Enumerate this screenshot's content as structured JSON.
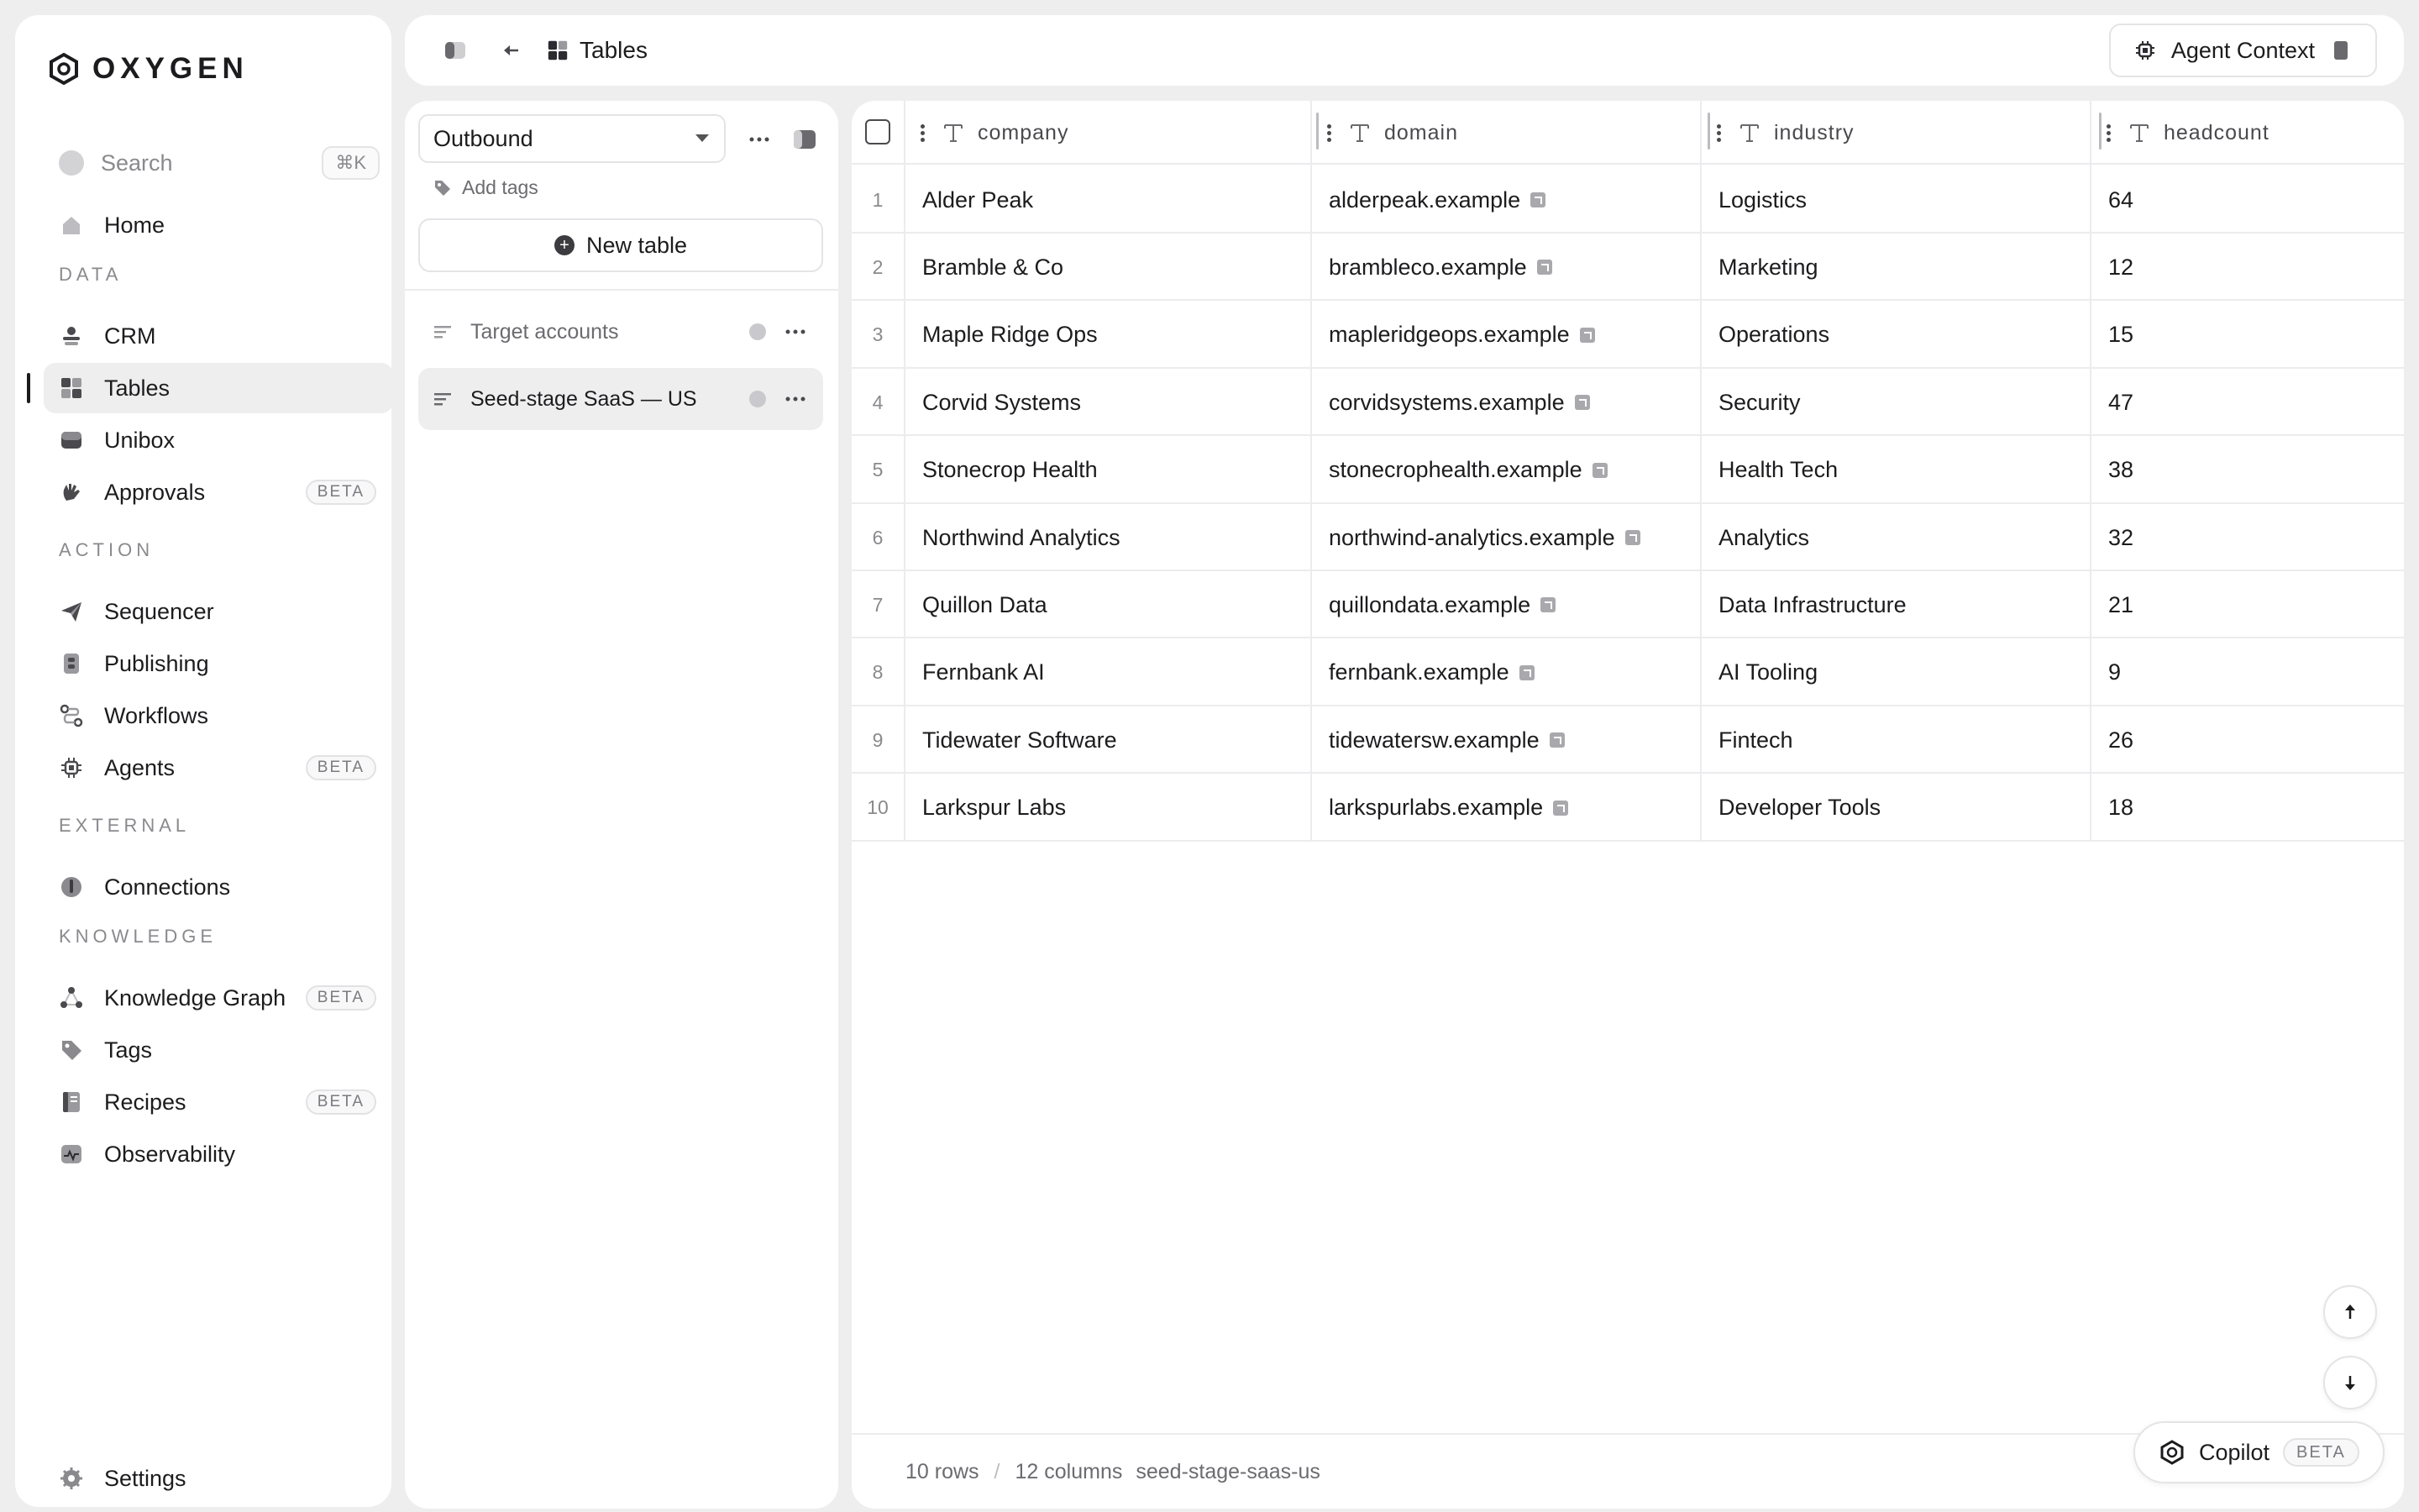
{
  "app": {
    "brand": "OXYGEN"
  },
  "sidebar": {
    "search": {
      "label": "Search",
      "shortcut": "⌘K"
    },
    "home": {
      "label": "Home"
    },
    "sections": [
      {
        "label": "DATA",
        "items": [
          {
            "label": "CRM",
            "icon": "users-icon"
          },
          {
            "label": "Tables",
            "icon": "grid-icon",
            "active": true
          },
          {
            "label": "Unibox",
            "icon": "inbox-icon"
          },
          {
            "label": "Approvals",
            "icon": "hand-icon",
            "badge": "BETA"
          }
        ]
      },
      {
        "label": "ACTION",
        "items": [
          {
            "label": "Sequencer",
            "icon": "send-icon"
          },
          {
            "label": "Publishing",
            "icon": "document-icon"
          },
          {
            "label": "Workflows",
            "icon": "workflow-icon"
          },
          {
            "label": "Agents",
            "icon": "chip-icon",
            "badge": "BETA"
          }
        ]
      },
      {
        "label": "EXTERNAL",
        "items": [
          {
            "label": "Connections",
            "icon": "plug-icon"
          }
        ]
      },
      {
        "label": "KNOWLEDGE",
        "items": [
          {
            "label": "Knowledge Graph",
            "icon": "graph-icon",
            "badge": "BETA"
          },
          {
            "label": "Tags",
            "icon": "tag-icon"
          },
          {
            "label": "Recipes",
            "icon": "book-icon",
            "badge": "BETA"
          },
          {
            "label": "Observability",
            "icon": "pulse-icon"
          }
        ]
      }
    ],
    "settings": {
      "label": "Settings"
    }
  },
  "header": {
    "breadcrumb": "Tables",
    "agent_context": "Agent Context"
  },
  "tables_panel": {
    "workspace": "Outbound",
    "add_tags": "Add tags",
    "new_table": "New table",
    "tables": [
      {
        "label": "Target accounts",
        "active": false
      },
      {
        "label": "Seed-stage SaaS — US",
        "active": true
      }
    ]
  },
  "grid": {
    "columns": [
      "company",
      "domain",
      "industry",
      "headcount"
    ],
    "rows": [
      {
        "n": "1",
        "company": "Alder Peak",
        "domain": "alderpeak.example",
        "industry": "Logistics",
        "headcount": "64"
      },
      {
        "n": "2",
        "company": "Bramble & Co",
        "domain": "brambleco.example",
        "industry": "Marketing",
        "headcount": "12"
      },
      {
        "n": "3",
        "company": "Maple Ridge Ops",
        "domain": "mapleridgeops.example",
        "industry": "Operations",
        "headcount": "15"
      },
      {
        "n": "4",
        "company": "Corvid Systems",
        "domain": "corvidsystems.example",
        "industry": "Security",
        "headcount": "47"
      },
      {
        "n": "5",
        "company": "Stonecrop Health",
        "domain": "stonecrophealth.example",
        "industry": "Health Tech",
        "headcount": "38"
      },
      {
        "n": "6",
        "company": "Northwind Analytics",
        "domain": "northwind-analytics.example",
        "industry": "Analytics",
        "headcount": "32"
      },
      {
        "n": "7",
        "company": "Quillon Data",
        "domain": "quillondata.example",
        "industry": "Data Infrastructure",
        "headcount": "21"
      },
      {
        "n": "8",
        "company": "Fernbank AI",
        "domain": "fernbank.example",
        "industry": "AI Tooling",
        "headcount": "9"
      },
      {
        "n": "9",
        "company": "Tidewater Software",
        "domain": "tidewatersw.example",
        "industry": "Fintech",
        "headcount": "26"
      },
      {
        "n": "10",
        "company": "Larkspur Labs",
        "domain": "larkspurlabs.example",
        "industry": "Developer Tools",
        "headcount": "18"
      }
    ],
    "footer": {
      "rows": "10 rows",
      "sep": "/",
      "columns": "12 columns",
      "slug": "seed-stage-saas-us"
    }
  },
  "copilot": {
    "label": "Copilot",
    "badge": "BETA"
  }
}
